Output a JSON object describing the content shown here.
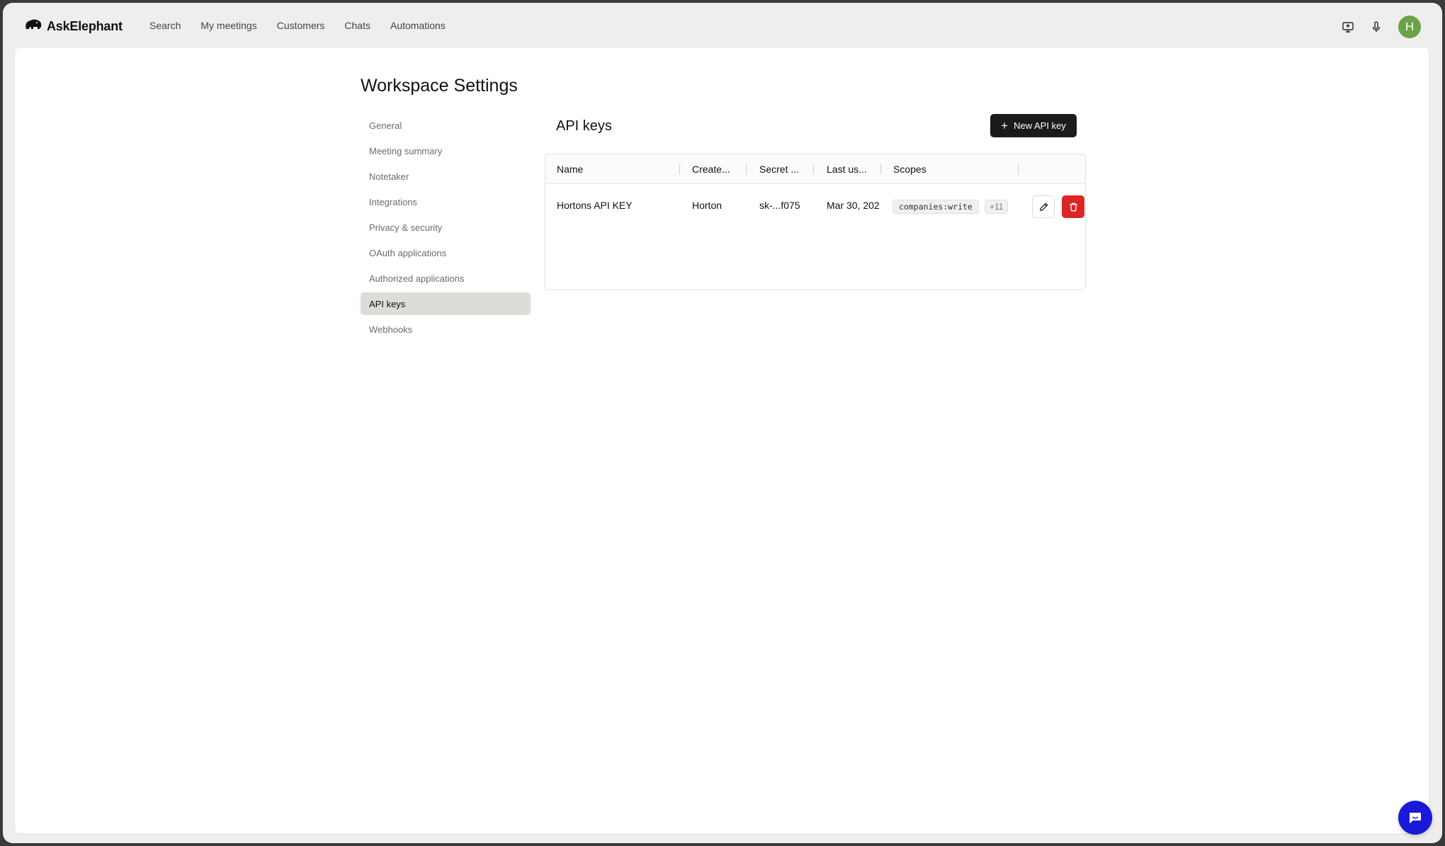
{
  "app": {
    "name": "AskElephant"
  },
  "nav": {
    "items": [
      "Search",
      "My meetings",
      "Customers",
      "Chats",
      "Automations"
    ]
  },
  "user": {
    "initial": "H",
    "avatar_color": "#6aa345"
  },
  "page": {
    "title": "Workspace Settings"
  },
  "sidebar": {
    "items": [
      {
        "label": "General",
        "active": false
      },
      {
        "label": "Meeting summary",
        "active": false
      },
      {
        "label": "Notetaker",
        "active": false
      },
      {
        "label": "Integrations",
        "active": false
      },
      {
        "label": "Privacy & security",
        "active": false
      },
      {
        "label": "OAuth applications",
        "active": false
      },
      {
        "label": "Authorized applications",
        "active": false
      },
      {
        "label": "API keys",
        "active": true
      },
      {
        "label": "Webhooks",
        "active": false
      }
    ]
  },
  "section": {
    "title": "API keys",
    "new_button_label": "New API key"
  },
  "table": {
    "columns": [
      "Name",
      "Create...",
      "Secret ...",
      "Last us...",
      "Scopes"
    ],
    "rows": [
      {
        "name": "Hortons API KEY",
        "created_by": "Horton",
        "secret": "sk-...f075",
        "last_used": "Mar 30, 202",
        "scope": "companies:write",
        "more_scopes": "+11"
      }
    ]
  },
  "colors": {
    "primary_button": "#1b1b1b",
    "danger": "#dc2626",
    "chat_fab": "#1a1ad6"
  },
  "icons": {
    "logo": "elephant-icon",
    "screen_share": "monitor-upload-icon",
    "mic": "microphone-icon",
    "edit": "pencil-icon",
    "delete": "trash-icon",
    "chat": "chat-bubble-icon",
    "add": "plus-icon"
  }
}
